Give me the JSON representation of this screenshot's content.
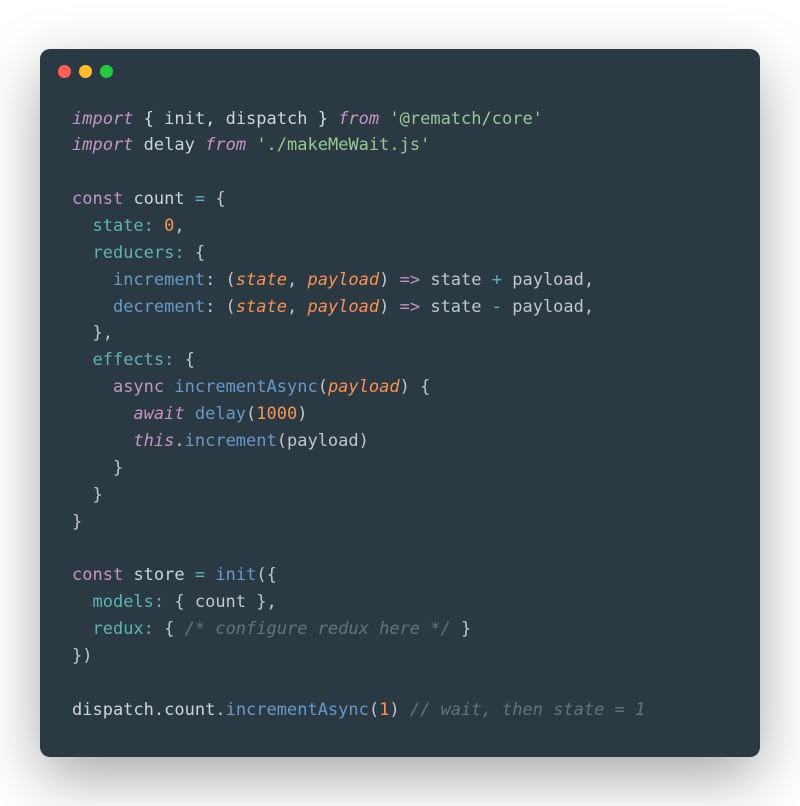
{
  "code": {
    "line1": {
      "t1": "import",
      "t2": " { ",
      "t3": "init",
      "t4": ", ",
      "t5": "dispatch",
      "t6": " } ",
      "t7": "from",
      "t8": " ",
      "t9": "'@rematch/core'"
    },
    "line2": {
      "t1": "import",
      "t2": " ",
      "t3": "delay",
      "t4": " ",
      "t5": "from",
      "t6": " ",
      "t7": "'./makeMeWait.js'"
    },
    "line4": {
      "t1": "const",
      "t2": " ",
      "t3": "count",
      "t4": " ",
      "t5": "=",
      "t6": " {"
    },
    "line5": {
      "t1": "  ",
      "t2": "state:",
      "t3": " ",
      "t4": "0",
      "t5": ","
    },
    "line6": {
      "t1": "  ",
      "t2": "reducers:",
      "t3": " {"
    },
    "line7": {
      "t1": "    ",
      "t2": "increment",
      "t3": ": (",
      "t4": "state",
      "t5": ", ",
      "t6": "payload",
      "t7": ") ",
      "t8": "=>",
      "t9": " state ",
      "t10": "+",
      "t11": " payload,"
    },
    "line8": {
      "t1": "    ",
      "t2": "decrement",
      "t3": ": (",
      "t4": "state",
      "t5": ", ",
      "t6": "payload",
      "t7": ") ",
      "t8": "=>",
      "t9": " state ",
      "t10": "-",
      "t11": " payload,"
    },
    "line9": {
      "t1": "  },"
    },
    "line10": {
      "t1": "  ",
      "t2": "effects:",
      "t3": " {"
    },
    "line11": {
      "t1": "    ",
      "t2": "async",
      "t3": " ",
      "t4": "incrementAsync",
      "t5": "(",
      "t6": "payload",
      "t7": ") {"
    },
    "line12": {
      "t1": "      ",
      "t2": "await",
      "t3": " ",
      "t4": "delay",
      "t5": "(",
      "t6": "1000",
      "t7": ")"
    },
    "line13": {
      "t1": "      ",
      "t2": "this",
      "t3": ".",
      "t4": "increment",
      "t5": "(payload)"
    },
    "line14": {
      "t1": "    }"
    },
    "line15": {
      "t1": "  }"
    },
    "line16": {
      "t1": "}"
    },
    "line18": {
      "t1": "const",
      "t2": " ",
      "t3": "store",
      "t4": " ",
      "t5": "=",
      "t6": " ",
      "t7": "init",
      "t8": "({"
    },
    "line19": {
      "t1": "  ",
      "t2": "models:",
      "t3": " { count },"
    },
    "line20": {
      "t1": "  ",
      "t2": "redux:",
      "t3": " { ",
      "t4": "/* configure redux here */",
      "t5": " }"
    },
    "line21": {
      "t1": "})"
    },
    "line23": {
      "t1": "dispatch",
      "t2": ".",
      "t3": "count",
      "t4": ".",
      "t5": "incrementAsync",
      "t6": "(",
      "t7": "1",
      "t8": ") ",
      "t9": "// wait, then state = 1"
    }
  }
}
